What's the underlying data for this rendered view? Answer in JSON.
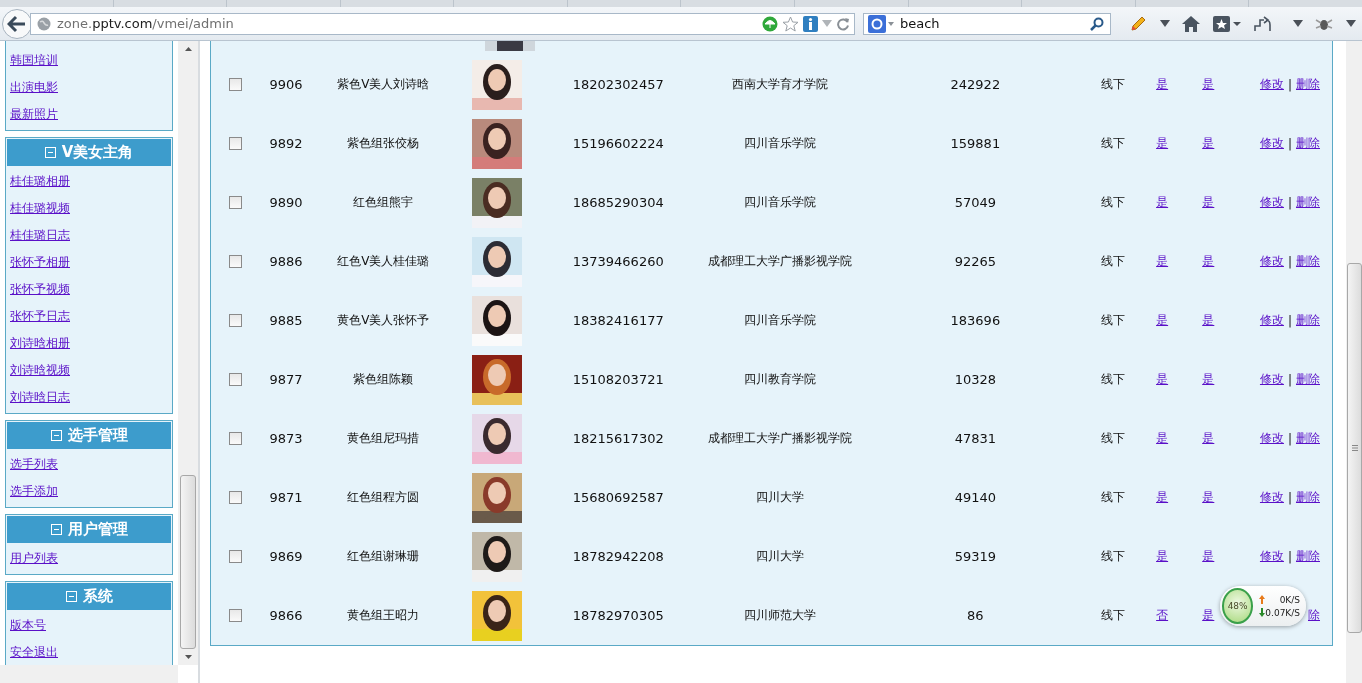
{
  "browser": {
    "url": {
      "host_prefix": "zone.",
      "domain": "pptv.com",
      "path": "/vmei/admin"
    },
    "search": "beach"
  },
  "sidebar": {
    "sections": [
      {
        "items": [
          "韩国培训",
          "出演电影",
          "最新照片"
        ]
      },
      {
        "title": "V美女主角",
        "items": [
          "桂佳璐相册",
          "桂佳璐视频",
          "桂佳璐日志",
          "张怀予相册",
          "张怀予视频",
          "张怀予日志",
          "刘诗晗相册",
          "刘诗晗视频",
          "刘诗晗日志"
        ]
      },
      {
        "title": "选手管理",
        "items": [
          "选手列表",
          "选手添加"
        ]
      },
      {
        "title": "用户管理",
        "items": [
          "用户列表"
        ]
      },
      {
        "title": "系统",
        "items": [
          "版本号",
          "安全退出"
        ]
      }
    ]
  },
  "table": {
    "rows": [
      {
        "checked": false,
        "id": "9906",
        "name": "紫色V美人刘诗晗",
        "phone": "18202302457",
        "school": "西南大学育才学院",
        "votes": "242922",
        "status": "线下",
        "column_8": "是",
        "column_9": "是",
        "actions": [
          {
            "kind": "link",
            "text": "修改"
          },
          {
            "kind": "separator",
            "text": "|"
          },
          {
            "kind": "link",
            "text": "删除"
          }
        ]
      },
      {
        "checked": false,
        "id": "9892",
        "name": "紫色组张佼杨",
        "phone": "15196602224",
        "school": "四川音乐学院",
        "votes": "159881",
        "status": "线下",
        "column_8": "是",
        "column_9": "是",
        "actions": [
          {
            "kind": "link",
            "text": "修改"
          },
          {
            "kind": "separator",
            "text": "|"
          },
          {
            "kind": "link",
            "text": "删除"
          }
        ]
      },
      {
        "checked": false,
        "id": "9890",
        "name": "红色组熊宇",
        "phone": "18685290304",
        "school": "四川音乐学院",
        "votes": "57049",
        "status": "线下",
        "column_8": "是",
        "column_9": "是",
        "actions": [
          {
            "kind": "link",
            "text": "修改"
          },
          {
            "kind": "separator",
            "text": "|"
          },
          {
            "kind": "link",
            "text": "删除"
          }
        ]
      },
      {
        "checked": false,
        "id": "9886",
        "name": "红色V美人桂佳璐",
        "phone": "13739466260",
        "school": "成都理工大学广播影视学院",
        "votes": "92265",
        "status": "线下",
        "column_8": "是",
        "column_9": "是",
        "actions": [
          {
            "kind": "link",
            "text": "修改"
          },
          {
            "kind": "separator",
            "text": "|"
          },
          {
            "kind": "link",
            "text": "删除"
          }
        ]
      },
      {
        "checked": false,
        "id": "9885",
        "name": "黄色V美人张怀予",
        "phone": "18382416177",
        "school": "四川音乐学院",
        "votes": "183696",
        "status": "线下",
        "column_8": "是",
        "column_9": "是",
        "actions": [
          {
            "kind": "link",
            "text": "修改"
          },
          {
            "kind": "separator",
            "text": "|"
          },
          {
            "kind": "link",
            "text": "删除"
          }
        ]
      },
      {
        "checked": false,
        "id": "9877",
        "name": "紫色组陈颖",
        "phone": "15108203721",
        "school": "四川教育学院",
        "votes": "10328",
        "status": "线下",
        "column_8": "是",
        "column_9": "是",
        "actions": [
          {
            "kind": "link",
            "text": "修改"
          },
          {
            "kind": "separator",
            "text": "|"
          },
          {
            "kind": "link",
            "text": "删除"
          }
        ]
      },
      {
        "checked": false,
        "id": "9873",
        "name": "黄色组尼玛措",
        "phone": "18215617302",
        "school": "成都理工大学广播影视学院",
        "votes": "47831",
        "status": "线下",
        "column_8": "是",
        "column_9": "是",
        "actions": [
          {
            "kind": "link",
            "text": "修改"
          },
          {
            "kind": "separator",
            "text": "|"
          },
          {
            "kind": "link",
            "text": "删除"
          }
        ]
      },
      {
        "checked": false,
        "id": "9871",
        "name": "红色组程方圆",
        "phone": "15680692587",
        "school": "四川大学",
        "votes": "49140",
        "status": "线下",
        "column_8": "是",
        "column_9": "是",
        "actions": [
          {
            "kind": "link",
            "text": "修改"
          },
          {
            "kind": "separator",
            "text": "|"
          },
          {
            "kind": "link",
            "text": "删除"
          }
        ]
      },
      {
        "checked": false,
        "id": "9869",
        "name": "红色组谢琳珊",
        "phone": "18782942208",
        "school": "四川大学",
        "votes": "59319",
        "status": "线下",
        "column_8": "是",
        "column_9": "是",
        "actions": [
          {
            "kind": "link",
            "text": "修改"
          },
          {
            "kind": "separator",
            "text": "|"
          },
          {
            "kind": "link",
            "text": "删除"
          }
        ]
      },
      {
        "checked": false,
        "id": "9866",
        "name": "黄色组王昭力",
        "phone": "18782970305",
        "school": "四川师范大学",
        "votes": "86",
        "status": "线下",
        "column_8": "否",
        "column_9": "是",
        "actions": [
          {
            "kind": "link",
            "text": "除"
          }
        ]
      }
    ]
  },
  "speed_widget": {
    "percent": "48%",
    "upload": "0K/S",
    "download": "0.07K/S"
  }
}
